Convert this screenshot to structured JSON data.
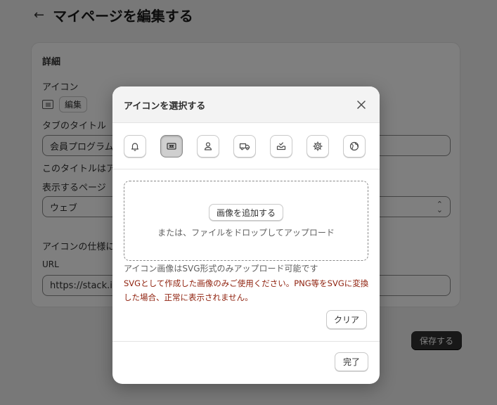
{
  "page": {
    "title": "マイページを編集する",
    "back_icon": "arrow-left-icon"
  },
  "card": {
    "title": "詳細",
    "icon_label": "アイコン",
    "edit_label": "編集",
    "tab_title_label": "タブのタイトル",
    "tab_title_value": "会員プログラム",
    "tab_title_help": "このタイトルはア",
    "display_page_label": "表示するページ",
    "display_page_value": "ウェブ",
    "icon_spec_label": "アイコンの仕様に",
    "url_label": "URL",
    "url_value": "https://stack.inc",
    "save_label": "保存する"
  },
  "modal": {
    "title": "アイコンを選択する",
    "close_icon": "close-icon",
    "icon_options": [
      {
        "name": "bell-icon",
        "selected": false
      },
      {
        "name": "ticket-icon",
        "selected": true
      },
      {
        "name": "person-icon",
        "selected": false
      },
      {
        "name": "truck-icon",
        "selected": false
      },
      {
        "name": "inbox-check-icon",
        "selected": false
      },
      {
        "name": "gear-icon",
        "selected": false
      },
      {
        "name": "globe-icon",
        "selected": false
      }
    ],
    "add_image_label": "画像を追加する",
    "drop_text": "または、ファイルをドロップしてアップロード",
    "help_text": "アイコン画像はSVG形式のみアップロード可能です",
    "warning_text": "SVGとして作成した画像のみご使用ください。PNG等をSVGに変換した場合、正常に表示されません。",
    "clear_label": "クリア",
    "done_label": "完了"
  },
  "colors": {
    "overlay": "#00000080",
    "warning": "#8e1f0b",
    "primary_button": "#303030"
  }
}
